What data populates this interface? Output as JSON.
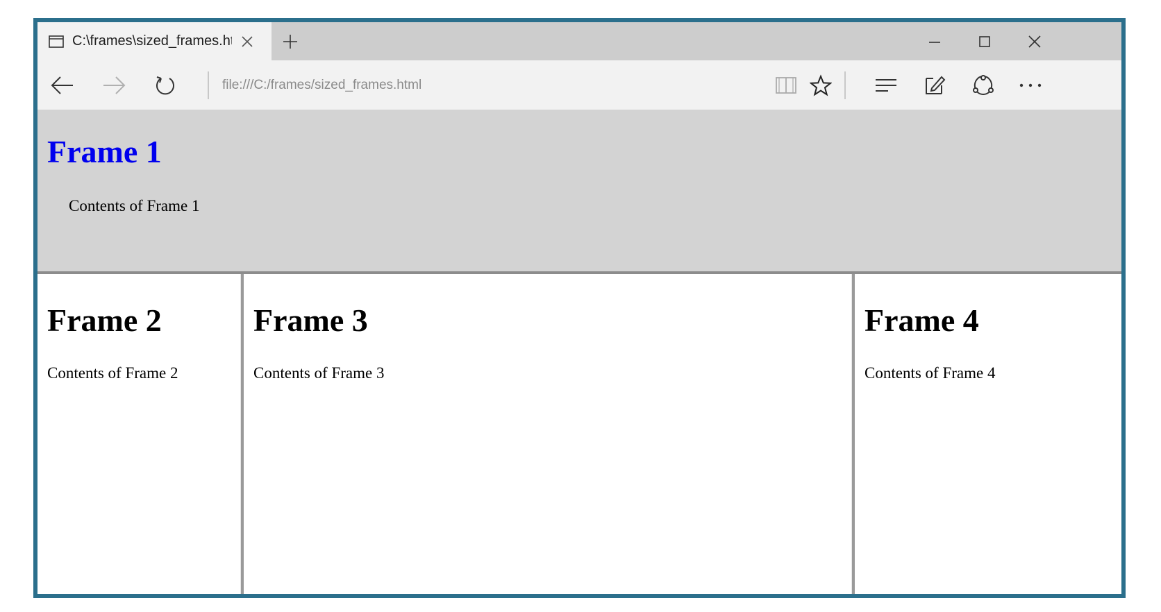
{
  "browser": {
    "tab": {
      "title": "C:\\frames\\sized_frames.html"
    },
    "address": "file:///C:/frames/sized_frames.html",
    "icons": {
      "tab": "page-icon",
      "close": "close-icon",
      "new_tab": "plus-icon",
      "minimize": "minimize-icon",
      "maximize": "maximize-icon",
      "window_close": "close-icon",
      "back": "back-arrow-icon",
      "forward": "forward-arrow-icon",
      "refresh": "refresh-icon",
      "reading_view": "book-icon",
      "favorite": "star-icon",
      "hub": "hub-icon",
      "notes": "web-note-icon",
      "share": "share-icon",
      "more": "more-icon"
    }
  },
  "frames": [
    {
      "title": "Frame 1",
      "content": "Contents of Frame 1"
    },
    {
      "title": "Frame 2",
      "content": "Contents of Frame 2"
    },
    {
      "title": "Frame 3",
      "content": "Contents of Frame 3"
    },
    {
      "title": "Frame 4",
      "content": "Contents of Frame 4"
    }
  ],
  "colors": {
    "window_border": "#2b6f8c",
    "frame1_background": "#d3d3d3",
    "frame1_heading": "#0000ee"
  }
}
